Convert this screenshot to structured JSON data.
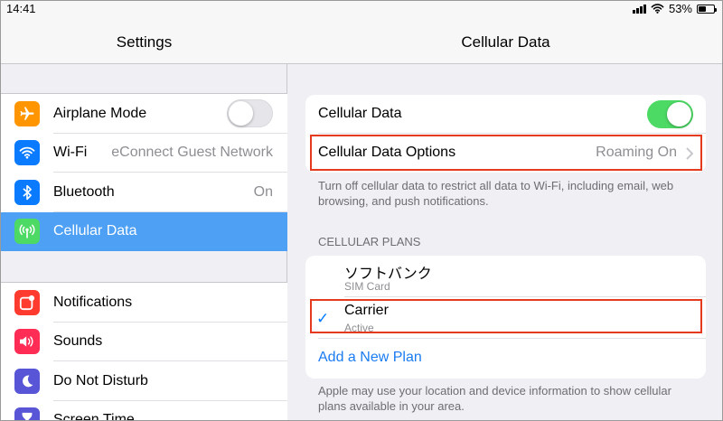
{
  "status_bar": {
    "time": "14:41",
    "battery_percent": "53%",
    "battery_level": 0.53
  },
  "sidebar": {
    "title": "Settings",
    "group1": [
      {
        "label": "Airplane Mode",
        "icon": "airplane-icon",
        "icon_color": "#ff9500",
        "toggle": false
      },
      {
        "label": "Wi-Fi",
        "value": "eConnect Guest Network",
        "icon": "wifi-icon",
        "icon_color": "#0a7aff"
      },
      {
        "label": "Bluetooth",
        "value": "On",
        "icon": "bluetooth-icon",
        "icon_color": "#0a7aff"
      },
      {
        "label": "Cellular Data",
        "icon": "antenna-icon",
        "icon_color": "#4cd964",
        "selected": true
      }
    ],
    "group2": [
      {
        "label": "Notifications",
        "icon": "notifications-icon",
        "icon_color": "#ff3b30"
      },
      {
        "label": "Sounds",
        "icon": "speaker-icon",
        "icon_color": "#ff2d55"
      },
      {
        "label": "Do Not Disturb",
        "icon": "moon-icon",
        "icon_color": "#5856d6"
      },
      {
        "label": "Screen Time",
        "icon": "hourglass-icon",
        "icon_color": "#5856d6"
      }
    ]
  },
  "detail": {
    "title": "Cellular Data",
    "cellular_data": {
      "label": "Cellular Data",
      "toggle": true
    },
    "options": {
      "label": "Cellular Data Options",
      "value": "Roaming On"
    },
    "footer1": "Turn off cellular data to restrict all data to Wi-Fi, including email, web browsing, and push notifications.",
    "plans_header": "CELLULAR PLANS",
    "plans": [
      {
        "name": "ソフトバンク",
        "status": "SIM Card",
        "checked": false
      },
      {
        "name": "Carrier",
        "status": "Active",
        "checked": true
      }
    ],
    "add_plan": "Add a New Plan",
    "footer2": "Apple may use your location and device information to show cellular plans available in your area."
  },
  "colors": {
    "accent": "#007aff",
    "selection": "#4ea0f5",
    "toggle_on": "#4cd964",
    "highlight": "#e53a1e"
  }
}
